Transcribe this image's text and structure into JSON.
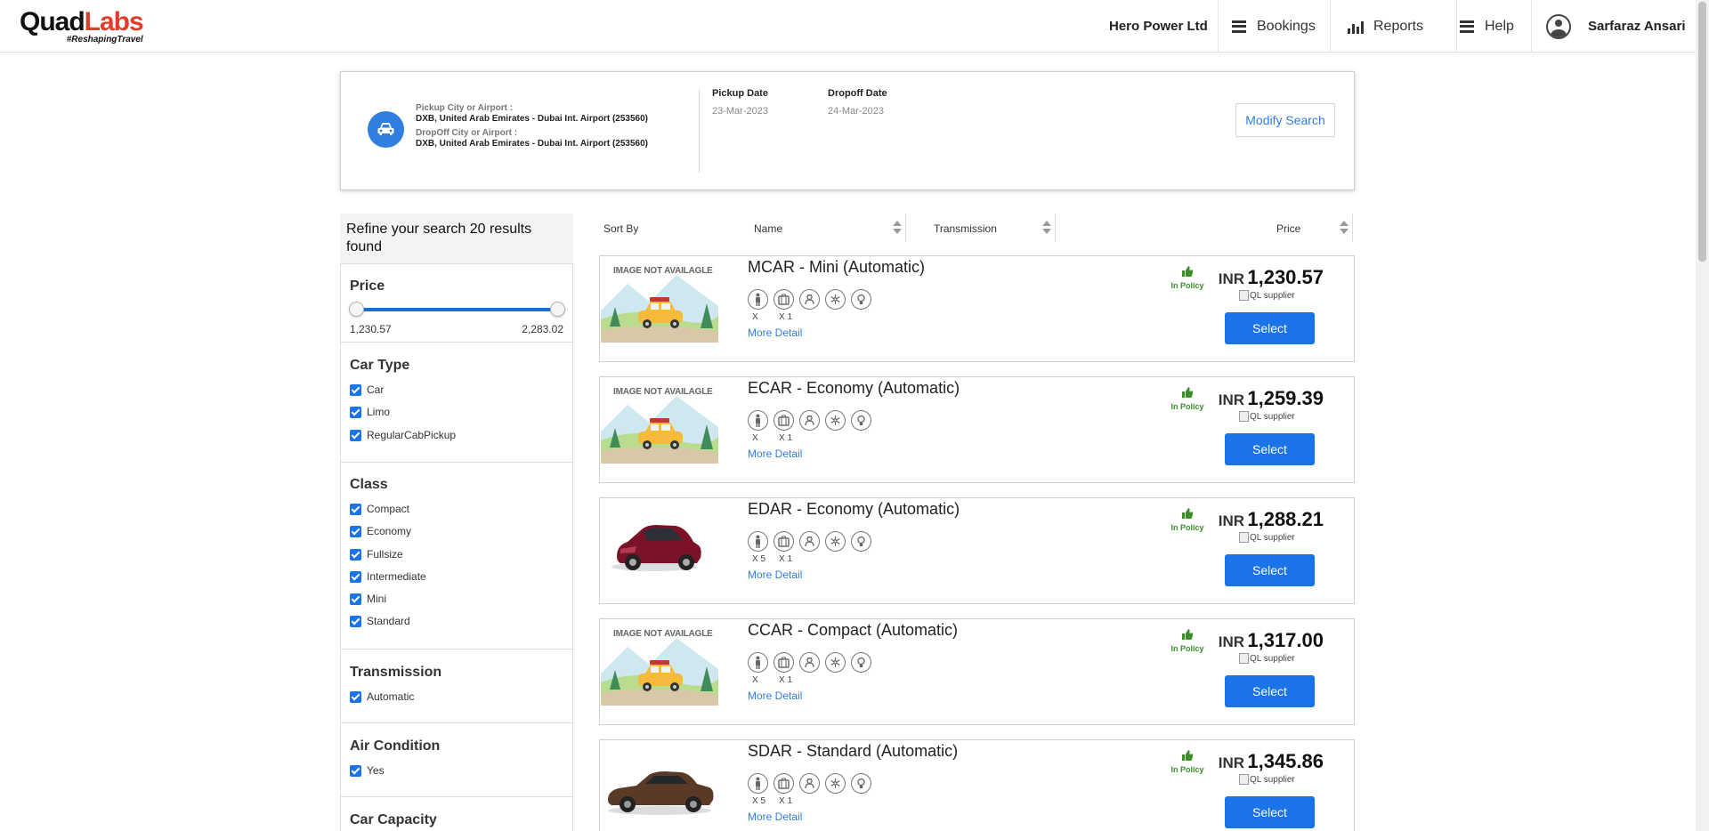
{
  "header": {
    "logo_main_a": "Quad",
    "logo_main_b": "Labs",
    "logo_tag": "#ReshapingTravel",
    "company": "Hero Power Ltd",
    "nav": [
      {
        "label": "Bookings",
        "icon": "menu-icon"
      },
      {
        "label": "Reports",
        "icon": "bar-chart-icon"
      },
      {
        "label": "Help",
        "icon": "menu-icon"
      }
    ],
    "user_name": "Sarfaraz Ansari"
  },
  "search": {
    "pickup_label": "Pickup City or Airport :",
    "pickup_value": "DXB, United Arab Emirates - Dubai Int. Airport (253560)",
    "dropoff_label": "DropOff City or Airport :",
    "dropoff_value": "DXB, United Arab Emirates - Dubai Int. Airport (253560)",
    "pickup_date_label": "Pickup Date",
    "pickup_date": "23-Mar-2023",
    "dropoff_date_label": "Dropoff Date",
    "dropoff_date": "24-Mar-2023",
    "modify_label": "Modify Search"
  },
  "sidebar": {
    "refine_text": "Refine your search 20 results found",
    "price": {
      "title": "Price",
      "min": "1,230.57",
      "max": "2,283.02"
    },
    "car_type": {
      "title": "Car Type",
      "options": [
        "Car",
        "Limo",
        "RegularCabPickup"
      ]
    },
    "class": {
      "title": "Class",
      "options": [
        "Compact",
        "Economy",
        "Fullsize",
        "Intermediate",
        "Mini",
        "Standard"
      ]
    },
    "transmission": {
      "title": "Transmission",
      "options": [
        "Automatic"
      ]
    },
    "air_condition": {
      "title": "Air Condition",
      "options": [
        "Yes"
      ]
    },
    "car_capacity": {
      "title": "Car Capacity"
    }
  },
  "sort": {
    "sort_by": "Sort By",
    "name": "Name",
    "transmission": "Transmission",
    "price": "Price"
  },
  "results": [
    {
      "title": "MCAR - Mini (Automatic)",
      "image": "image-not-available",
      "image_text": "IMAGE NOT AVAILAGLE",
      "pax": "X",
      "bags": "X 1",
      "more": "More Detail",
      "policy": "In Policy",
      "currency": "INR",
      "price": "1,230.57",
      "supplier_alt": "QL supplier",
      "select": "Select"
    },
    {
      "title": "ECAR - Economy (Automatic)",
      "image": "image-not-available",
      "image_text": "IMAGE NOT AVAILAGLE",
      "pax": "X",
      "bags": "X 1",
      "more": "More Detail",
      "policy": "In Policy",
      "currency": "INR",
      "price": "1,259.39",
      "supplier_alt": "QL supplier",
      "select": "Select"
    },
    {
      "title": "EDAR - Economy (Automatic)",
      "image": "red-hatchback",
      "image_text": "",
      "pax": "X 5",
      "bags": "X 1",
      "more": "More Detail",
      "policy": "In Policy",
      "currency": "INR",
      "price": "1,288.21",
      "supplier_alt": "QL supplier",
      "select": "Select"
    },
    {
      "title": "CCAR - Compact (Automatic)",
      "image": "image-not-available",
      "image_text": "IMAGE NOT AVAILAGLE",
      "pax": "X",
      "bags": "X 1",
      "more": "More Detail",
      "policy": "In Policy",
      "currency": "INR",
      "price": "1,317.00",
      "supplier_alt": "QL supplier",
      "select": "Select"
    },
    {
      "title": "SDAR - Standard (Automatic)",
      "image": "brown-sedan",
      "image_text": "",
      "pax": "X 5",
      "bags": "X 1",
      "more": "More Detail",
      "policy": "In Policy",
      "currency": "INR",
      "price": "1,345.86",
      "supplier_alt": "QL supplier",
      "select": "Select"
    }
  ],
  "colors": {
    "primary": "#1a73e8",
    "policy_green": "#3a8f2a",
    "logo_red": "#e23c2c"
  }
}
